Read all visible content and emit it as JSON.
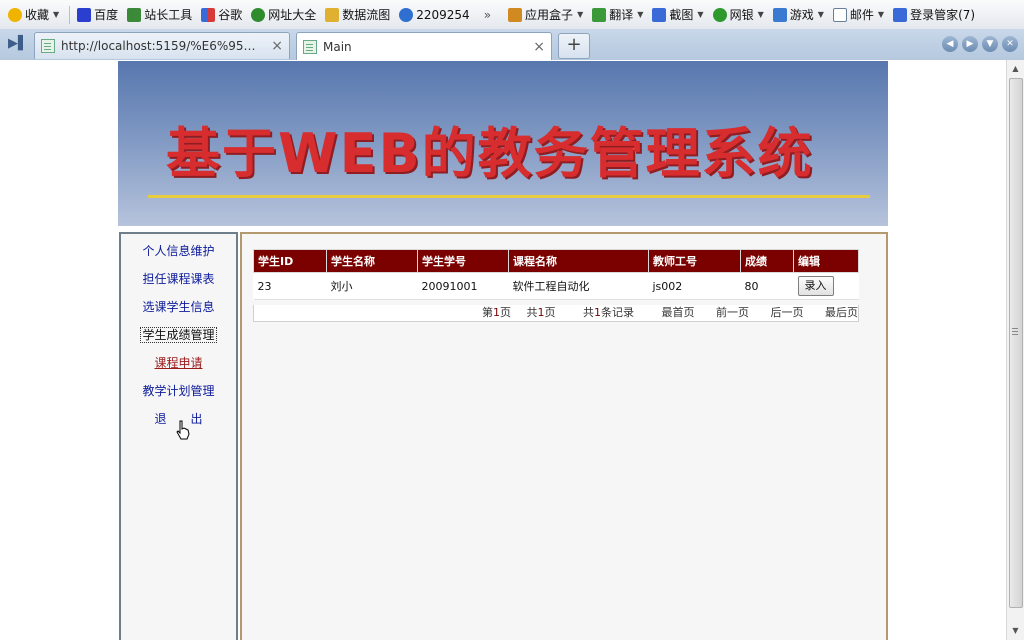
{
  "favorites": [
    {
      "label": "收藏",
      "icon": "star-icon",
      "color": "#e0a000",
      "caret": true
    },
    {
      "label": "百度",
      "icon": "baidu-icon",
      "color": "#2a3fd0"
    },
    {
      "label": "站长工具",
      "icon": "webpage-icon",
      "color": "#3a8a3a"
    },
    {
      "label": "谷歌",
      "icon": "google-icon",
      "color": "#3a6ad8"
    },
    {
      "label": "网址大全",
      "icon": "globe-icon",
      "color": "#2e8b2e"
    },
    {
      "label": "数据流图",
      "icon": "folder-icon",
      "color": "#e0b030"
    },
    {
      "label": "2209254",
      "icon": "ie-icon",
      "color": "#2f6fd0"
    }
  ],
  "more_label": "»",
  "tools": [
    {
      "label": "应用盒子",
      "icon": "box-icon",
      "color": "#d08a20"
    },
    {
      "label": "翻译",
      "icon": "translate-icon",
      "color": "#3a9a3a"
    },
    {
      "label": "截图",
      "icon": "screenshot-icon",
      "color": "#3a6ad8"
    },
    {
      "label": "网银",
      "icon": "bank-icon",
      "color": "#2e9a2e"
    },
    {
      "label": "游戏",
      "icon": "game-icon",
      "color": "#3a7ad0"
    },
    {
      "label": "邮件",
      "icon": "mail-icon",
      "color": "#6b7f9a"
    },
    {
      "label": "登录管家(7)",
      "icon": "key-icon",
      "color": "#3a6ad8"
    }
  ],
  "tabs": [
    {
      "title": "http://localhost:5159/%E6%95%9...",
      "close": "×"
    },
    {
      "title": "Main",
      "close": "×"
    }
  ],
  "new_tab": "+",
  "banner": {
    "title": "基于WEB的教务管理系统"
  },
  "menu": [
    {
      "label": "个人信息维护"
    },
    {
      "label": "担任课程课表"
    },
    {
      "label": "选课学生信息"
    },
    {
      "label": "学生成绩管理"
    },
    {
      "label": "课程申请"
    },
    {
      "label": "教学计划管理"
    },
    {
      "label": "退　　出"
    }
  ],
  "grid": {
    "headers": [
      "学生ID",
      "学生名称",
      "学生学号",
      "课程名称",
      "教师工号",
      "成绩",
      "编辑"
    ],
    "rows": [
      {
        "id": "23",
        "name": "刘小",
        "no": "20091001",
        "course": "软件工程自动化",
        "teacher": "js002",
        "score": "80",
        "action": "录入"
      }
    ]
  },
  "pager": {
    "page_prefix": "第",
    "page": "1",
    "page_suffix": "页",
    "total_prefix": "共",
    "total": "1",
    "total_suffix": "页",
    "records_prefix": "共",
    "records": "1",
    "records_suffix": "条记录",
    "first": "最首页",
    "prev": "前一页",
    "next": "后一页",
    "last": "最后页"
  }
}
